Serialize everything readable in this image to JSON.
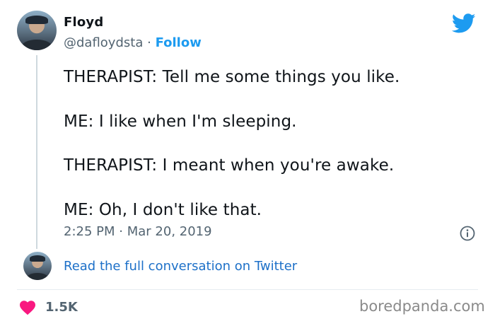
{
  "author": {
    "name": "Floyd",
    "handle": "@dafloydsta",
    "separator": "·",
    "follow_label": "Follow"
  },
  "tweet": {
    "lines": [
      "THERAPIST: Tell me some things you like.",
      "ME: I like when I'm sleeping.",
      "THERAPIST: I meant when you're awake.",
      "ME: Oh, I don't like that."
    ],
    "time": "2:25 PM",
    "separator": "·",
    "date": "Mar 20, 2019"
  },
  "conversation_link": "Read the full conversation on Twitter",
  "likes": "1.5K",
  "watermark": "boredpanda.com",
  "icons": {
    "brand": "twitter-bird-icon",
    "info": "info-icon",
    "like": "heart-icon"
  },
  "colors": {
    "twitter_blue": "#1d9bf0",
    "heart": "#f91880",
    "muted_text": "#536471"
  }
}
